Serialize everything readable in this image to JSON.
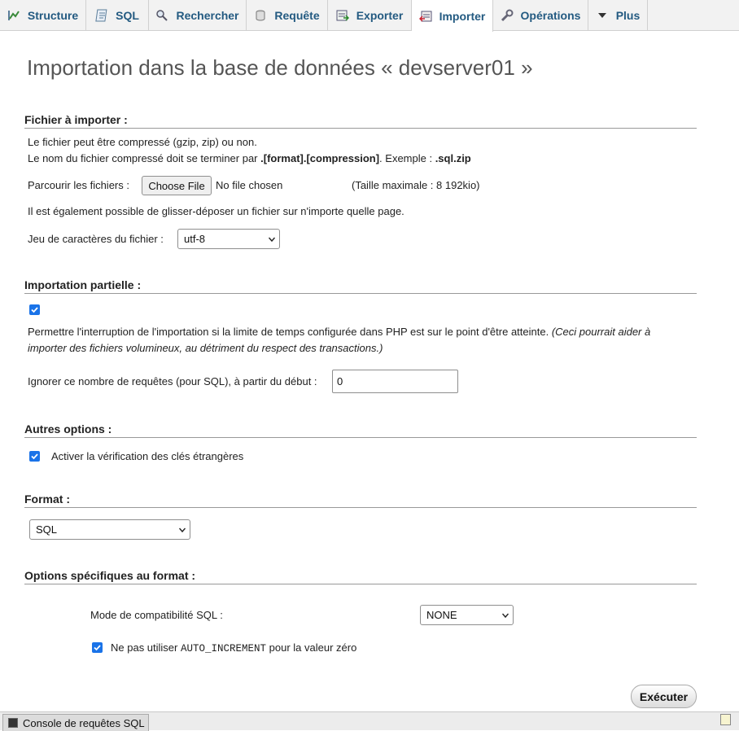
{
  "tabs": [
    {
      "label": "Structure",
      "icon": "structure-icon"
    },
    {
      "label": "SQL",
      "icon": "sql-icon"
    },
    {
      "label": "Rechercher",
      "icon": "search-icon"
    },
    {
      "label": "Requête",
      "icon": "query-icon"
    },
    {
      "label": "Exporter",
      "icon": "export-icon"
    },
    {
      "label": "Importer",
      "icon": "import-icon",
      "active": true
    },
    {
      "label": "Opérations",
      "icon": "wrench-icon"
    },
    {
      "label": "Plus",
      "icon": "chevron-down-icon"
    }
  ],
  "title": "Importation dans la base de données « devserver01 »",
  "file_section": {
    "legend": "Fichier à importer :",
    "line1": "Le fichier peut être compressé (gzip, zip) ou non.",
    "line2_prefix": "Le nom du fichier compressé doit se terminer par ",
    "line2_bold1": ".[format].[compression]",
    "line2_mid": ". Exemple : ",
    "line2_bold2": ".sql.zip",
    "browse_label": "Parcourir les fichiers :",
    "choose_button": "Choose File",
    "no_file": "No file chosen",
    "max_size": "(Taille maximale : 8 192kio)",
    "dragdrop": "Il est également possible de glisser-déposer un fichier sur n'importe quelle page.",
    "charset_label": "Jeu de caractères du fichier :",
    "charset_value": "utf-8"
  },
  "partial_section": {
    "legend": "Importation partielle :",
    "allow_interrupt_checked": true,
    "interrupt_text": "Permettre l'interruption de l'importation si la limite de temps configurée dans PHP est sur le point d'être atteinte.",
    "interrupt_note_1": "(Ceci pourrait aider à",
    "interrupt_note_2": "importer des fichiers volumineux, au détriment du respect des transactions.)",
    "skip_label": "Ignorer ce nombre de requêtes (pour SQL), à partir du début :",
    "skip_value": "0"
  },
  "other_section": {
    "legend": "Autres options :",
    "fk_checked": true,
    "fk_label": "Activer la vérification des clés étrangères"
  },
  "format_section": {
    "legend": "Format :",
    "format_value": "SQL"
  },
  "format_options": {
    "legend": "Options spécifiques au format :",
    "compat_label": "Mode de compatibilité SQL :",
    "compat_value": "NONE",
    "noautoinc_checked": true,
    "noautoinc_prefix": "Ne pas utiliser ",
    "noautoinc_code": "AUTO_INCREMENT",
    "noautoinc_suffix": " pour la valeur zéro"
  },
  "execute_button": "Exécuter",
  "console": {
    "label": "Console de requêtes SQL"
  },
  "colors": {
    "tab_text": "#235a81",
    "checkbox": "#1a73e8",
    "title": "#555555"
  }
}
